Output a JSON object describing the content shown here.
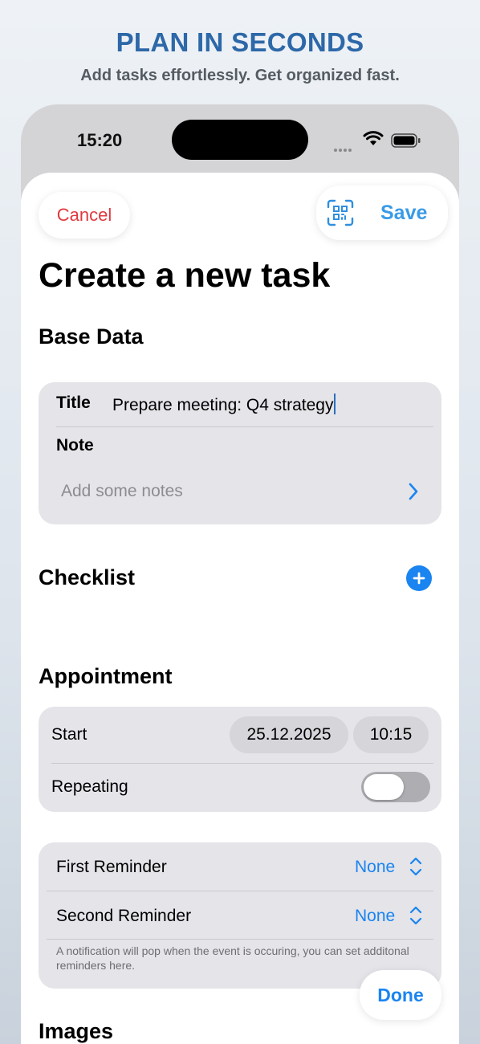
{
  "promo": {
    "headline": "PLAN IN SECONDS",
    "subline": "Add tasks effortlessly. Get organized fast."
  },
  "status_bar": {
    "time": "15:20"
  },
  "header": {
    "cancel_label": "Cancel",
    "save_label": "Save",
    "scan_icon": "qr-scan-icon"
  },
  "page_title": "Create a new task",
  "base_data": {
    "section_title": "Base Data",
    "title_label": "Title",
    "title_value": "Prepare meeting: Q4 strategy",
    "note_label": "Note",
    "note_placeholder": "Add some notes"
  },
  "checklist": {
    "section_title": "Checklist"
  },
  "appointment": {
    "section_title": "Appointment",
    "start_label": "Start",
    "start_date": "25.12.2025",
    "start_time": "10:15",
    "repeating_label": "Repeating",
    "repeating_on": false
  },
  "reminders": {
    "first_label": "First Reminder",
    "first_value": "None",
    "second_label": "Second Reminder",
    "second_value": "None",
    "footnote": "A notification will pop when the event is occuring, you can set additonal reminders here."
  },
  "done_label": "Done",
  "images": {
    "section_title": "Images"
  },
  "colors": {
    "accent": "#1a84f0",
    "destructive": "#e0393e",
    "headline": "#2d68a8"
  }
}
